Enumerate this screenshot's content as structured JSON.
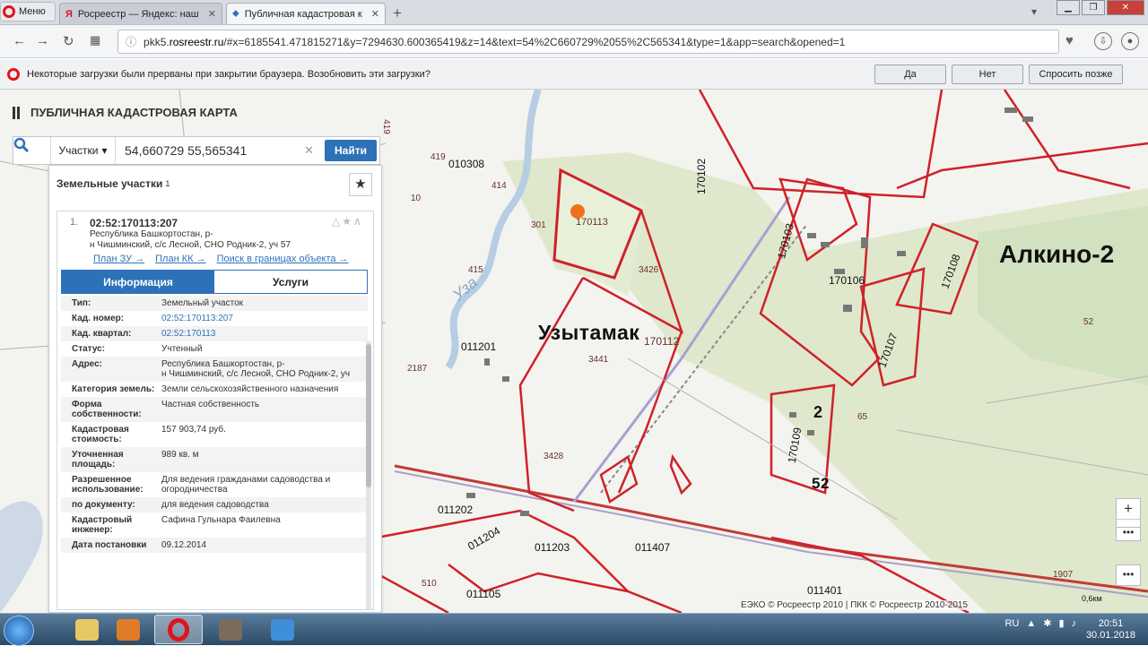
{
  "browser": {
    "menu_label": "Меню",
    "tabs": [
      {
        "label": "Росреестр — Яндекс: наш",
        "icon": "yandex-icon",
        "active": false
      },
      {
        "label": "Публичная кадастровая к",
        "icon": "map-icon",
        "active": true
      }
    ],
    "url_prefix": "pkk5.",
    "url_domain": "rosreestr.ru",
    "url_rest": "/#x=6185541.471815271&y=7294630.600365419&z=14&text=54%2C660729%2055%2C565341&type=1&app=search&opened=1",
    "download_message": "Некоторые загрузки были прерваны при закрытии браузера. Возобновить эти загрузки?",
    "download_buttons": {
      "yes": "Да",
      "no": "Нет",
      "later": "Спросить позже"
    }
  },
  "app": {
    "title": "ПУБЛИЧНАЯ КАДАСТРОВАЯ КАРТА",
    "search": {
      "mode": "Участки",
      "query": "54,660729 55,565341",
      "button": "Найти"
    },
    "panel": {
      "header": "Земельные участки",
      "count": "1",
      "item": {
        "index": "1.",
        "cad_number": "02:52:170113:207",
        "address_line1": "Республика Башкортостан, р-",
        "address_line2": "н Чишминский, с/с Лесной, СНО Родник-2, уч 57",
        "links": [
          "План ЗУ →",
          "План КК →",
          "Поиск в границах объекта →"
        ],
        "tabs": [
          "Информация",
          "Услуги"
        ],
        "rows": [
          {
            "k": "Тип:",
            "v": "Земельный участок"
          },
          {
            "k": "Кад. номер:",
            "v": "02:52:170113:207"
          },
          {
            "k": "Кад. квартал:",
            "v": "02:52:170113"
          },
          {
            "k": "Статус:",
            "v": "Учтенный"
          },
          {
            "k": "Адрес:",
            "v": "Республика Башкортостан, р-",
            "v2": "н Чишминский, с/с Лесной, СНО Родник-2, уч"
          },
          {
            "k": "Категория земель:",
            "v": "Земли сельскохозяйственного назначения"
          },
          {
            "k": "Форма",
            "k2": "собственности:",
            "v": "Частная собственность"
          },
          {
            "k": "Кадастровая",
            "k2": "стоимость:",
            "v": "157 903,74 руб."
          },
          {
            "k": "Уточненная",
            "k2": "площадь:",
            "v": "989 кв. м"
          },
          {
            "k": "Разрешенное",
            "k2": "использование:",
            "v": "Для ведения гражданами садоводства и",
            "v2": "огородничества"
          },
          {
            "k": "по документу:",
            "v": "для ведения садоводства"
          },
          {
            "k": "Кадастровый",
            "k2": "инженер:",
            "v": "Сафина Гульнара Фаилевна"
          },
          {
            "k": "Дата постановки",
            "v": "09.12.2014"
          }
        ]
      }
    }
  },
  "map": {
    "labels": {
      "uzytamak": "Узытамак",
      "alkino": "Алкино-2",
      "river": "Уза",
      "l170113": "170113",
      "l3426": "3426",
      "l170112": "170112",
      "l3441": "3441",
      "l3428": "3428",
      "l010308": "010308",
      "l414": "414",
      "l419a": "419",
      "l419b": "419",
      "l10": "10",
      "l301": "301",
      "l415": "415",
      "l011201": "011201",
      "l2187": "2187",
      "l011202": "011202",
      "l011204": "011204",
      "l011203": "011203",
      "l011407": "011407",
      "l011105": "011105",
      "l510a": "510",
      "l510b": "510",
      "l170102": "170102",
      "l170103": "170103",
      "l170106": "170106",
      "l170108": "170108",
      "l170107": "170107",
      "l170109": "170109",
      "l2": "2",
      "l52a": "52",
      "l52b": "52",
      "l65": "65",
      "l1907": "1907",
      "l011401": "011401"
    },
    "copyright": "ЕЭКО © Росреестр 2010 | ПКК © Росреестр 2010-2015",
    "scale": "0,6км"
  },
  "taskbar": {
    "lang": "RU",
    "time": "20:51",
    "date": "30.01.2018"
  },
  "colors": {
    "parcel": "#d0212a",
    "accent": "#2d72b8",
    "marker": "#f0701a"
  }
}
